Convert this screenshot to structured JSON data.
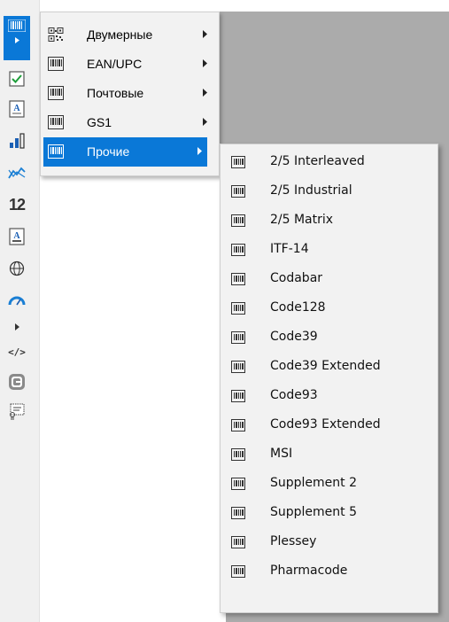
{
  "colors": {
    "accent": "#0a78d7",
    "menu_bg": "#f2f2f2",
    "backdrop_gray": "#ababab",
    "toolbar_bg": "#f0f0f0"
  },
  "toolbar": {
    "tools": [
      {
        "icon": "barcode-tool-icon",
        "active": true
      },
      {
        "icon": "checkbox-tool-icon"
      },
      {
        "icon": "text-tool-icon"
      },
      {
        "icon": "bar-chart-tool-icon"
      },
      {
        "icon": "line-chart-tool-icon"
      },
      {
        "icon": "number-tool-icon",
        "label": "12"
      },
      {
        "icon": "text-frame-tool-icon"
      },
      {
        "icon": "globe-tool-icon"
      },
      {
        "icon": "gauge-tool-icon"
      },
      {
        "icon": "expand-arrow-icon"
      },
      {
        "icon": "code-tool-icon",
        "label": "</>"
      },
      {
        "icon": "shape-tool-icon"
      },
      {
        "icon": "certificate-tool-icon"
      }
    ]
  },
  "menu_level1": {
    "items": [
      {
        "label": "Двумерные",
        "icon": "qr-code-icon"
      },
      {
        "label": "EAN/UPC",
        "icon": "barcode-icon"
      },
      {
        "label": "Почтовые",
        "icon": "barcode-icon"
      },
      {
        "label": "GS1",
        "icon": "barcode-icon"
      },
      {
        "label": "Прочие",
        "icon": "barcode-icon",
        "selected": true
      }
    ]
  },
  "menu_level2": {
    "items": [
      {
        "label": "2/5 Interleaved"
      },
      {
        "label": "2/5 Industrial"
      },
      {
        "label": "2/5 Matrix"
      },
      {
        "label": "ITF-14"
      },
      {
        "label": "Codabar"
      },
      {
        "label": "Code128"
      },
      {
        "label": "Code39"
      },
      {
        "label": "Code39 Extended"
      },
      {
        "label": "Code93"
      },
      {
        "label": "Code93 Extended"
      },
      {
        "label": "MSI"
      },
      {
        "label": "Supplement 2"
      },
      {
        "label": "Supplement 5"
      },
      {
        "label": "Plessey"
      },
      {
        "label": "Pharmacode"
      }
    ]
  }
}
